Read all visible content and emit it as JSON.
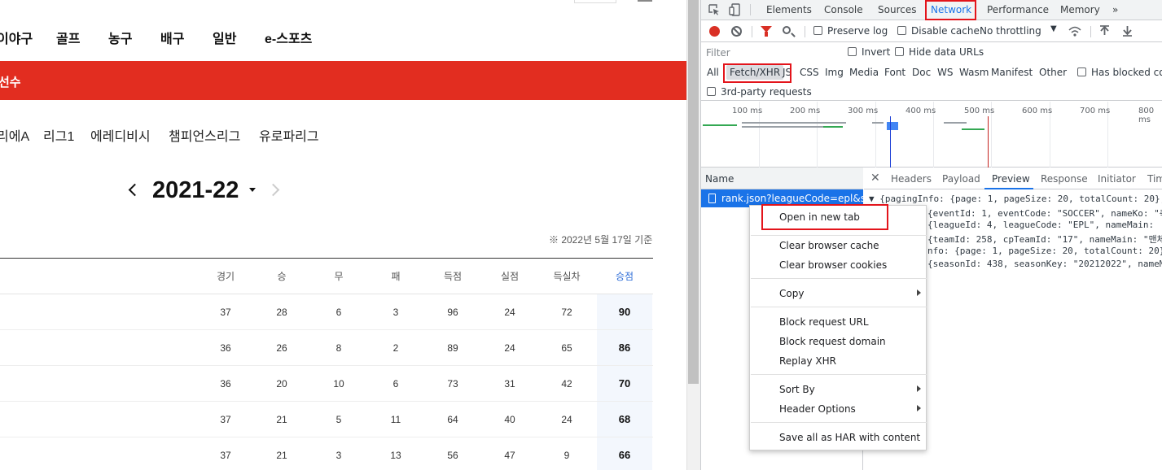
{
  "page": {
    "sports_nav": [
      "이야구",
      "골프",
      "농구",
      "배구",
      "일반",
      "e-스포츠"
    ],
    "red_bar_label": "선수",
    "league_nav": [
      "리에A",
      "리그1",
      "에레디비시",
      "챔피언스리그",
      "유로파리그"
    ],
    "season": "2021-22",
    "as_of": "※ 2022년 5월 17일 기준",
    "table": {
      "columns": [
        "경기",
        "승",
        "무",
        "패",
        "득점",
        "실점",
        "득실차",
        "승점"
      ],
      "rows": [
        [
          "37",
          "28",
          "6",
          "3",
          "96",
          "24",
          "72",
          "90"
        ],
        [
          "36",
          "26",
          "8",
          "2",
          "89",
          "24",
          "65",
          "86"
        ],
        [
          "36",
          "20",
          "10",
          "6",
          "73",
          "31",
          "42",
          "70"
        ],
        [
          "37",
          "21",
          "5",
          "11",
          "64",
          "40",
          "24",
          "68"
        ],
        [
          "37",
          "21",
          "3",
          "13",
          "56",
          "47",
          "9",
          "66"
        ]
      ]
    }
  },
  "devtools": {
    "tabs": [
      "Elements",
      "Console",
      "Sources",
      "Network",
      "Performance",
      "Memory",
      "»"
    ],
    "active_tab": "Network",
    "toolbar": {
      "preserve_log": "Preserve log",
      "disable_cache": "Disable cache",
      "throttling": "No throttling"
    },
    "filter_placeholder": "Filter",
    "invert": "Invert",
    "hide_data_urls": "Hide data URLs",
    "type_filters": [
      "All",
      "Fetch/XHR",
      "JS",
      "CSS",
      "Img",
      "Media",
      "Font",
      "Doc",
      "WS",
      "Wasm",
      "Manifest",
      "Other"
    ],
    "active_type_filter": "Fetch/XHR",
    "has_blocked_cookies": "Has blocked coo",
    "third_party": "3rd-party requests",
    "overview_ticks": [
      "100 ms",
      "200 ms",
      "300 ms",
      "400 ms",
      "500 ms",
      "600 ms",
      "700 ms",
      "800 ms"
    ],
    "name_header": "Name",
    "request_name": "rank.json?leagueCode=epl&s...",
    "preview_tabs": [
      "Headers",
      "Payload",
      "Preview",
      "Response",
      "Initiator",
      "Tim"
    ],
    "active_preview_tab": "Preview",
    "preview_lines": [
      "▼ {pagingInfo: {page: 1, pageSize: 20, totalCount: 20},",
      "{eventId: 1, eventCode: \"SOCCER\", nameKo: \"축",
      "{leagueId: 4, leagueCode: \"EPL\", nameMain:",
      "{teamId: 258, cpTeamId: \"17\", nameMain: \"맨체",
      "nfo: {page: 1, pageSize: 20, totalCount: 20}",
      "{seasonId: 438, seasonKey: \"20212022\", nameM"
    ],
    "context_menu": {
      "groups": [
        [
          "Open in new tab"
        ],
        [
          "Clear browser cache",
          "Clear browser cookies"
        ],
        [
          "Copy"
        ],
        [
          "Block request URL",
          "Block request domain",
          "Replay XHR"
        ],
        [
          "Sort By",
          "Header Options"
        ],
        [
          "Save all as HAR with content"
        ]
      ]
    }
  },
  "colors": {
    "accent_red": "#e22d20",
    "devtools_blue": "#1a73e8",
    "highlight_box": "#e3141b"
  }
}
